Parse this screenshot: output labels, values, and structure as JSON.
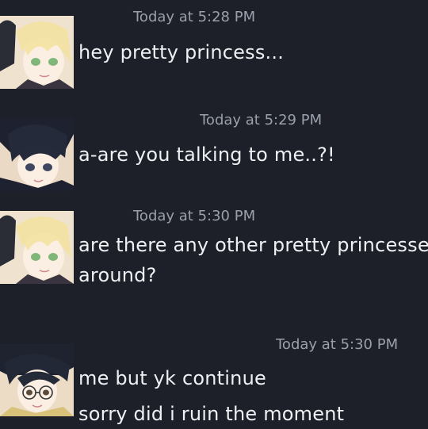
{
  "messages": [
    {
      "avatar": "blonde-anime-avatar",
      "timestamp": "Today at 5:28 PM",
      "lines": [
        "hey pretty princess..."
      ]
    },
    {
      "avatar": "dark-haired-anime-avatar",
      "timestamp": "Today at 5:29 PM",
      "lines": [
        "a-are you talking to me..?!"
      ]
    },
    {
      "avatar": "blonde-anime-avatar",
      "timestamp": "Today at 5:30 PM",
      "lines": [
        "are there any other pretty princesses",
        "around?"
      ]
    },
    {
      "avatar": "glasses-anime-avatar",
      "timestamp": "Today at 5:30 PM",
      "lines": [
        "me but yk continue",
        "sorry did i ruin the moment"
      ]
    }
  ],
  "colors": {
    "background": "#1d2029",
    "timestamp": "#9aa0aa",
    "message_text": "#eef0f3"
  }
}
